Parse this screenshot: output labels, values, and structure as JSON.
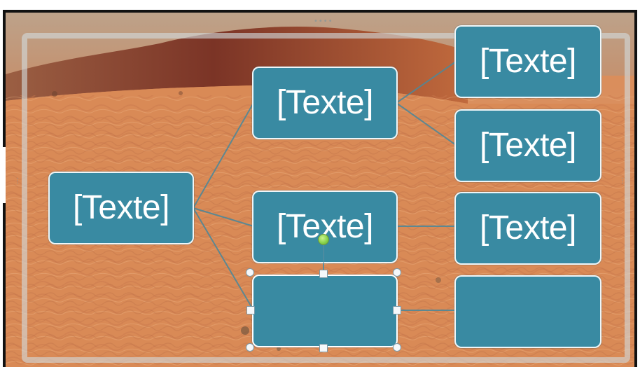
{
  "slide": {
    "background": "desert photograph",
    "selection_frame_color": "#d2dadc",
    "top_dots": "••••",
    "side_dots": "⋮"
  },
  "smartart": {
    "node_color": "#398aa2",
    "node_text_color": "#ffffff",
    "nodes": [
      {
        "id": "root",
        "text": "[Texte]"
      },
      {
        "id": "level2_top",
        "text": "[Texte]"
      },
      {
        "id": "level2_middle",
        "text": "[Texte]"
      },
      {
        "id": "level2_bottom_selected",
        "text": ""
      },
      {
        "id": "level3_top",
        "text": "[Texte]"
      },
      {
        "id": "level3_second",
        "text": "[Texte]"
      },
      {
        "id": "level3_third",
        "text": "[Texte]"
      },
      {
        "id": "level3_bottom",
        "text": ""
      }
    ]
  }
}
